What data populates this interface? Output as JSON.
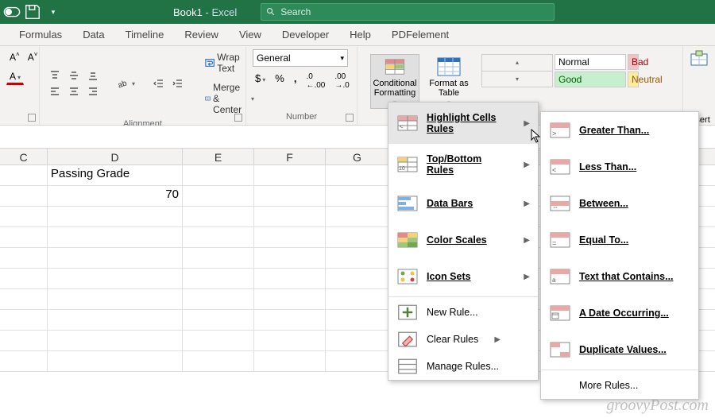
{
  "titlebar": {
    "title": "Book1",
    "app": "Excel",
    "search_placeholder": "Search"
  },
  "tabs": [
    "Formulas",
    "Data",
    "Timeline",
    "Review",
    "View",
    "Developer",
    "Help",
    "PDFelement"
  ],
  "groups": {
    "alignment_label": "Alignment",
    "number_label": "Number",
    "wrap": "Wrap Text",
    "merge": "Merge & Center",
    "number_format": "General"
  },
  "styles": {
    "cond_fmt": "Conditional Formatting",
    "fmt_table": "Format as Table",
    "normal": "Normal",
    "bad": "Bad",
    "good": "Good",
    "neutral": "Neutral",
    "insert": "Insert"
  },
  "sheet": {
    "columns": [
      "C",
      "D",
      "E",
      "F",
      "G"
    ],
    "cells": {
      "D1": "Passing Grade",
      "D2": "70"
    }
  },
  "cf_menu": {
    "highlight": "Highlight Cells Rules",
    "topbottom": "Top/Bottom Rules",
    "databars": "Data Bars",
    "colorscales": "Color Scales",
    "iconsets": "Icon Sets",
    "newrule": "New Rule...",
    "clear": "Clear Rules",
    "manage": "Manage Rules..."
  },
  "hcr_menu": {
    "greater": "Greater Than...",
    "less": "Less Than...",
    "between": "Between...",
    "equal": "Equal To...",
    "contains": "Text that Contains...",
    "date": "A Date Occurring...",
    "dup": "Duplicate Values...",
    "more": "More Rules..."
  },
  "watermark": "groovyPost.com"
}
